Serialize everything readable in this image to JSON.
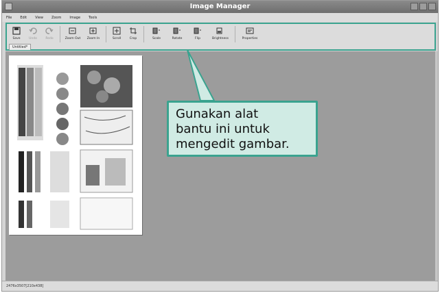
{
  "window": {
    "title": "Image Manager"
  },
  "menubar": {
    "items": [
      "File",
      "Edit",
      "View",
      "Zoom",
      "Image",
      "Tools"
    ]
  },
  "toolbar": {
    "save": "Save",
    "undo": "Undo",
    "redo": "Redo",
    "zoom_out": "Zoom Out",
    "zoom_in": "Zoom In",
    "scroll": "Scroll",
    "crop": "Crop",
    "scale": "Scale",
    "rotate": "Rotate",
    "flip": "Flip",
    "brightness": "Brightness",
    "properties": "Properties"
  },
  "tabs": [
    "Untitled*"
  ],
  "status": {
    "text": "2476x3507[210x438]"
  },
  "callout": {
    "line1": "Gunakan alat",
    "line2": "bantu ini untuk",
    "line3": "mengedit gambar."
  },
  "colors": {
    "accent": "#3aa38f",
    "callout_bg": "#d0ebe4",
    "canvas_bg": "#9c9c9c"
  }
}
